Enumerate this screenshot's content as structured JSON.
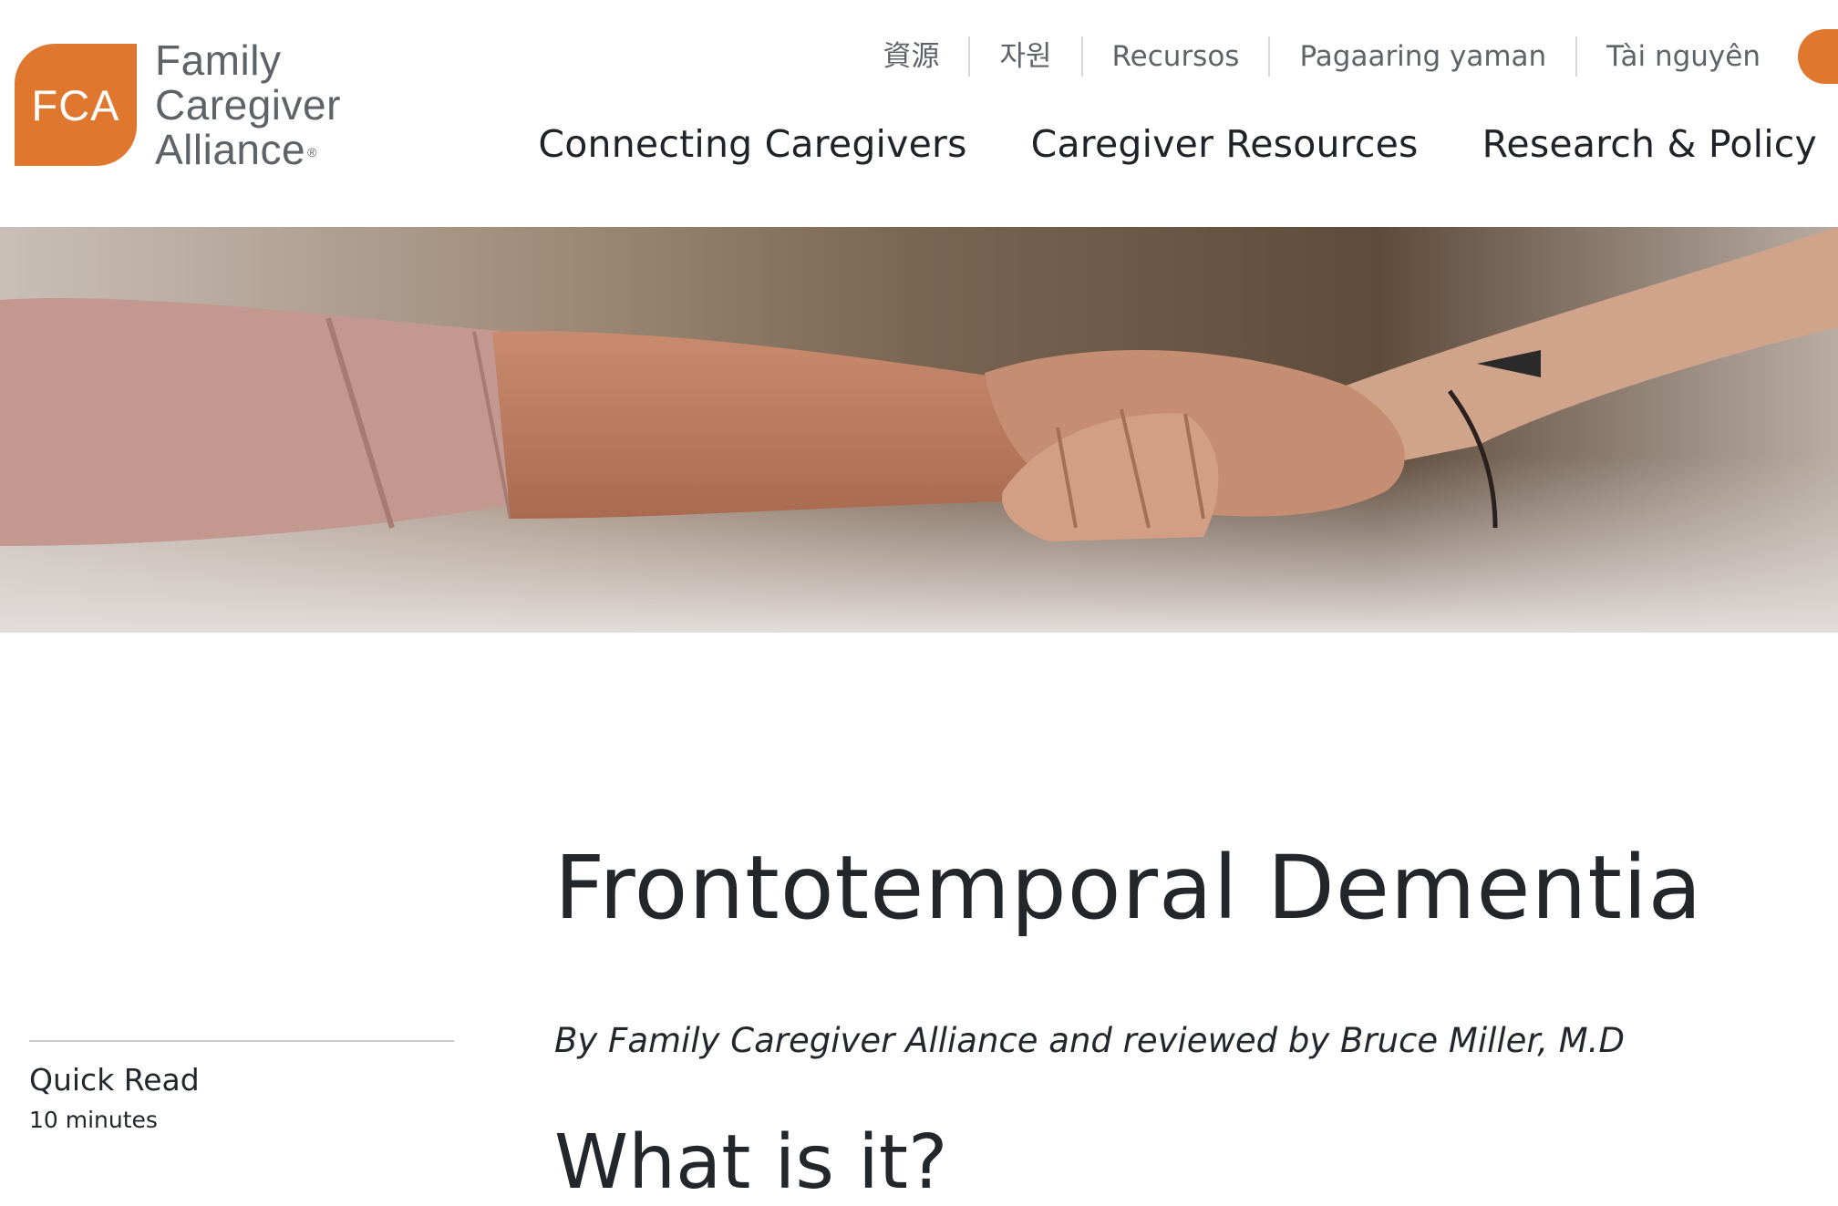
{
  "logo": {
    "mark": "FCA",
    "lines": [
      "Family",
      "Caregiver",
      "Alliance"
    ],
    "registered": "®"
  },
  "languages": [
    "資源",
    "자원",
    "Recursos",
    "Pagaaring yaman",
    "Tài nguyên"
  ],
  "nav": [
    "Connecting Caregivers",
    "Caregiver Resources",
    "Research & Policy"
  ],
  "hero": {
    "image_alt": "two-hands-clasped-photo"
  },
  "article": {
    "title": "Frontotemporal Dementia",
    "byline": "By Family Caregiver Alliance and reviewed by Bruce Miller, M.D",
    "section_heading": "What is it?"
  },
  "sidebar": {
    "quick_read_label": "Quick Read",
    "quick_read_time": "10 minutes"
  },
  "colors": {
    "brand_orange": "#e0772f",
    "text_dark": "#23262b",
    "text_gray": "#5f6368"
  }
}
